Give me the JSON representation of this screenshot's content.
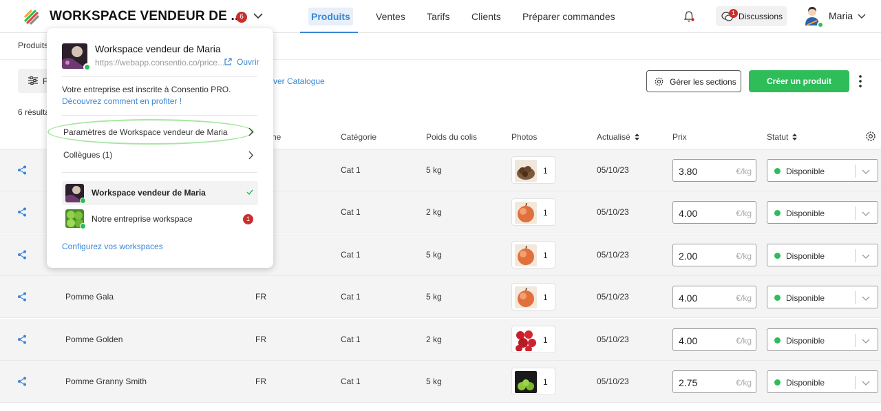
{
  "header": {
    "workspace_title": "WORKSPACE VENDEUR DE ...",
    "workspace_badge": "6",
    "nav": [
      {
        "label": "Produits",
        "active": true
      },
      {
        "label": "Ventes",
        "active": false
      },
      {
        "label": "Tarifs",
        "active": false
      },
      {
        "label": "Clients",
        "active": false
      },
      {
        "label": "Préparer commandes",
        "active": false
      }
    ],
    "discussions_label": "Discussions",
    "discussions_badge": "1",
    "user_name": "Maria"
  },
  "breadcrumb": "Produits",
  "toolbar": {
    "filter_label": "F",
    "catalog_link": "ver Catalogue",
    "sections_label": "Gérer les sections",
    "create_label": "Créer un produit"
  },
  "results_text": "6 résulta",
  "table": {
    "columns": {
      "origin": "ne",
      "category": "Catégorie",
      "weight": "Poids du colis",
      "photos": "Photos",
      "updated": "Actualisé",
      "price": "Prix",
      "status": "Statut"
    },
    "price_unit": "€/kg",
    "rows": [
      {
        "name": "",
        "origin": "",
        "category": "Cat 1",
        "weight": "5 kg",
        "photo_count": "1",
        "photo_icon": "chestnut-photo",
        "updated": "05/10/23",
        "price": "3.80",
        "status": "Disponible"
      },
      {
        "name": "",
        "origin": "",
        "category": "Cat 1",
        "weight": "2 kg",
        "photo_count": "1",
        "photo_icon": "apple-photo",
        "updated": "05/10/23",
        "price": "4.00",
        "status": "Disponible"
      },
      {
        "name": "",
        "origin": "",
        "category": "Cat 1",
        "weight": "5 kg",
        "photo_count": "1",
        "photo_icon": "apple-photo",
        "updated": "05/10/23",
        "price": "2.00",
        "status": "Disponible"
      },
      {
        "name": "Pomme Gala",
        "origin": "FR",
        "category": "Cat 1",
        "weight": "5 kg",
        "photo_count": "1",
        "photo_icon": "apple-photo",
        "updated": "05/10/23",
        "price": "4.00",
        "status": "Disponible"
      },
      {
        "name": "Pomme Golden",
        "origin": "FR",
        "category": "Cat 1",
        "weight": "2 kg",
        "photo_count": "1",
        "photo_icon": "apples-photo",
        "updated": "05/10/23",
        "price": "4.00",
        "status": "Disponible"
      },
      {
        "name": "Pomme Granny Smith",
        "origin": "FR",
        "category": "Cat 1",
        "weight": "5 kg",
        "photo_count": "1",
        "photo_icon": "green-apples-photo",
        "updated": "05/10/23",
        "price": "2.75",
        "status": "Disponible"
      }
    ]
  },
  "popover": {
    "workspace_name": "Workspace vendeur de Maria",
    "url": "https://webapp.consentio.co/price...",
    "open_label": "Ouvrir",
    "info_text": "Votre entreprise est inscrite à Consentio PRO.",
    "info_link": "Découvrez comment en profiter !",
    "settings_label": "Paramètres de Workspace vendeur de Maria",
    "colleagues_label": "Collègues (1)",
    "workspaces": [
      {
        "name": "Workspace vendeur de Maria",
        "selected": true,
        "badge": ""
      },
      {
        "name": "Notre entreprise workspace",
        "selected": false,
        "badge": "1"
      }
    ],
    "configure_link": "Configurez vos workspaces"
  },
  "colors": {
    "accent": "#3a86d4",
    "green": "#2ebd59",
    "badge_red": "#c9302c",
    "highlight": "#a6e6a0"
  }
}
